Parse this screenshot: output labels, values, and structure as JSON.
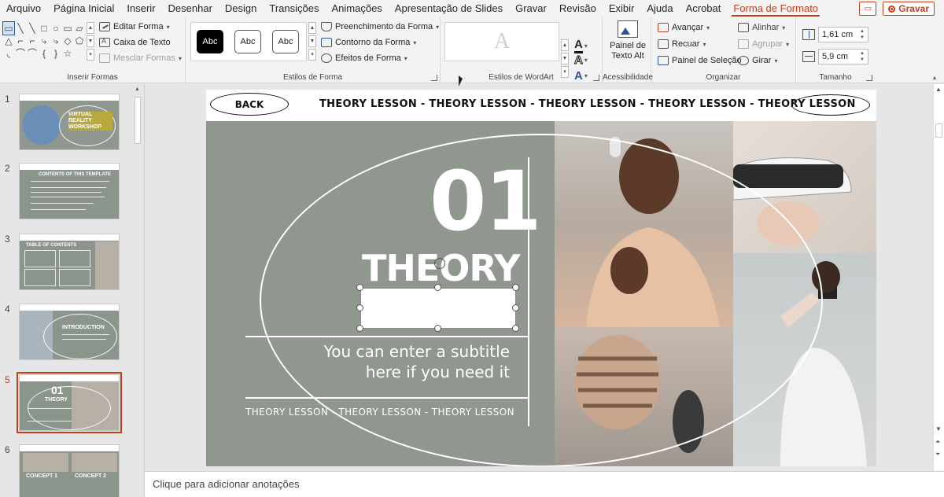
{
  "menu": {
    "items": [
      "Arquivo",
      "Página Inicial",
      "Inserir",
      "Desenhar",
      "Design",
      "Transições",
      "Animações",
      "Apresentação de Slides",
      "Gravar",
      "Revisão",
      "Exibir",
      "Ajuda",
      "Acrobat",
      "Forma de Formato"
    ],
    "active_index": 13,
    "record_label": "Gravar"
  },
  "ribbon": {
    "insert_shapes": {
      "label": "Inserir Formas",
      "shape_glyphs": [
        "▭",
        "╲",
        "╲",
        "□",
        "○",
        "▭",
        "▱",
        "△",
        "⌐",
        "⌐",
        "⤷",
        "⤷",
        "◇",
        "⬠",
        "◟",
        "⌒",
        "⌒",
        "{",
        "}",
        "☆",
        ""
      ],
      "edit_shape": "Editar Forma",
      "text_box": "Caixa de Texto",
      "merge_shapes": "Mesclar Formas"
    },
    "shape_styles": {
      "label": "Estilos de Forma",
      "presets": [
        "Abc",
        "Abc",
        "Abc"
      ],
      "fill": "Preenchimento da Forma",
      "outline": "Contorno da Forma",
      "effects": "Efeitos de Forma"
    },
    "wordart": {
      "label": "Estilos de WordArt",
      "preview_glyph": "A",
      "tool_glyph": "A"
    },
    "accessibility": {
      "label": "Acessibilidade",
      "alt_text_line1": "Painel de",
      "alt_text_line2": "Texto Alt"
    },
    "arrange": {
      "label": "Organizar",
      "bring_forward": "Avançar",
      "send_backward": "Recuar",
      "selection_pane": "Painel de Seleção",
      "align": "Alinhar",
      "group": "Agrupar",
      "rotate": "Girar"
    },
    "size": {
      "label": "Tamanho",
      "height": "1,61 cm",
      "width": "5,9 cm"
    }
  },
  "thumbnails": {
    "numbers": [
      "1",
      "2",
      "3",
      "4",
      "5",
      "6"
    ],
    "selected_index": 4,
    "t1_title": "VIRTUAL REALITY WORKSHOP",
    "t2_title": "CONTENTS OF THIS TEMPLATE",
    "t3_title": "TABLE OF CONTENTS",
    "t4_title": "INTRODUCTION",
    "t5_num": "01",
    "t5_title": "THEORY",
    "t6_c1": "CONCEPT 1",
    "t6_c2": "CONCEPT 2"
  },
  "slide": {
    "back_label": "BACK",
    "header_text": "THEORY LESSON - THEORY LESSON - THEORY LESSON - THEORY LESSON - THEORY LESSON",
    "number": "01",
    "title": "THEORY",
    "subtitle_line1": "You can enter a subtitle",
    "subtitle_line2": "here if you need it",
    "bottom_text": "THEORY LESSON - THEORY LESSON - THEORY LESSON"
  },
  "notes": {
    "placeholder": "Clique para adicionar anotações"
  },
  "colors": {
    "accent": "#c43e1c",
    "slide_bg": "#8f978f"
  }
}
